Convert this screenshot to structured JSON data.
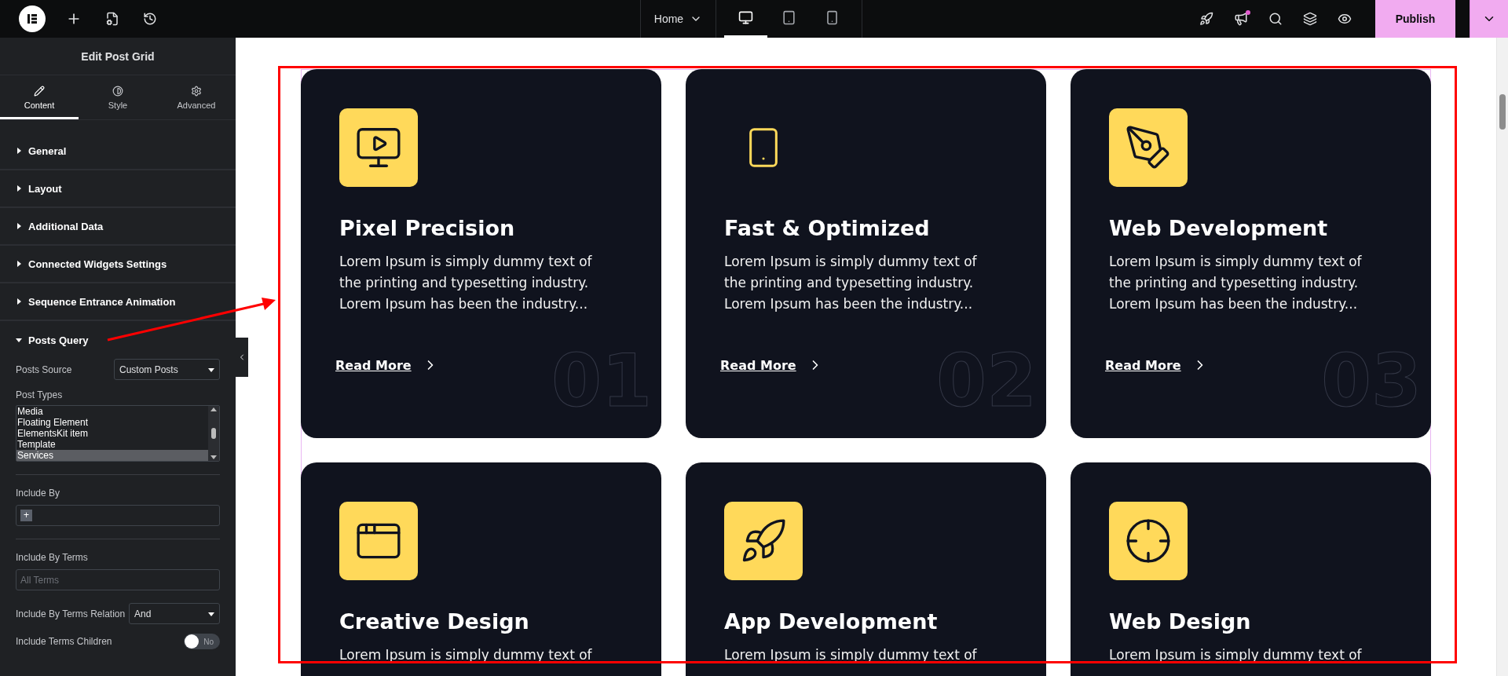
{
  "topbar": {
    "page_menu": "Home",
    "devices": [
      {
        "selected": true
      },
      {
        "selected": false
      },
      {
        "selected": false
      }
    ],
    "publish": "Publish"
  },
  "sidebar": {
    "title": "Edit Post Grid",
    "tabs": [
      {
        "label": "Content",
        "selected": true
      },
      {
        "label": "Style",
        "selected": false
      },
      {
        "label": "Advanced",
        "selected": false
      }
    ],
    "sections": [
      {
        "label": "General",
        "expanded": false
      },
      {
        "label": "Layout",
        "expanded": false
      },
      {
        "label": "Additional Data",
        "expanded": false
      },
      {
        "label": "Connected Widgets Settings",
        "expanded": false
      },
      {
        "label": "Sequence Entrance Animation",
        "expanded": false
      },
      {
        "label": "Posts Query",
        "expanded": true
      }
    ],
    "posts_source": {
      "label": "Posts Source",
      "value": "Custom Posts"
    },
    "post_types": {
      "label": "Post Types",
      "options": [
        {
          "label": "Media",
          "selected": false
        },
        {
          "label": "Floating Element",
          "selected": false
        },
        {
          "label": "ElementsKit item",
          "selected": false
        },
        {
          "label": "Template",
          "selected": false
        },
        {
          "label": "Services",
          "selected": true
        }
      ]
    },
    "include_by": {
      "label": "Include By",
      "add": "+"
    },
    "include_by_terms": {
      "label": "Include By Terms",
      "placeholder": "All Terms"
    },
    "terms_relation": {
      "label": "Include By Terms Relation",
      "value": "And"
    },
    "include_terms_children": {
      "label": "Include Terms Children",
      "on": false,
      "text": "No"
    }
  },
  "cards": [
    {
      "title": "Pixel Precision",
      "description": "Lorem Ipsum is simply dummy text of the printing and typesetting industry. Lorem Ipsum has been the industry...",
      "link": "Read More",
      "number": "01",
      "icon_boxed": true
    },
    {
      "title": "Fast & Optimized",
      "description": "Lorem Ipsum is simply dummy text of the printing and typesetting industry. Lorem Ipsum has been the industry...",
      "link": "Read More",
      "number": "02",
      "icon_boxed": false
    },
    {
      "title": "Web Development",
      "description": "Lorem Ipsum is simply dummy text of the printing and typesetting industry. Lorem Ipsum has been the industry...",
      "link": "Read More",
      "number": "03",
      "icon_boxed": true
    },
    {
      "title": "Creative Design",
      "description": "Lorem Ipsum is simply dummy text of",
      "icon_boxed": true
    },
    {
      "title": "App Development",
      "description": "Lorem Ipsum is simply dummy text of",
      "icon_boxed": true
    },
    {
      "title": "Web Design",
      "description": "Lorem Ipsum is simply dummy text of",
      "icon_boxed": true
    }
  ]
}
